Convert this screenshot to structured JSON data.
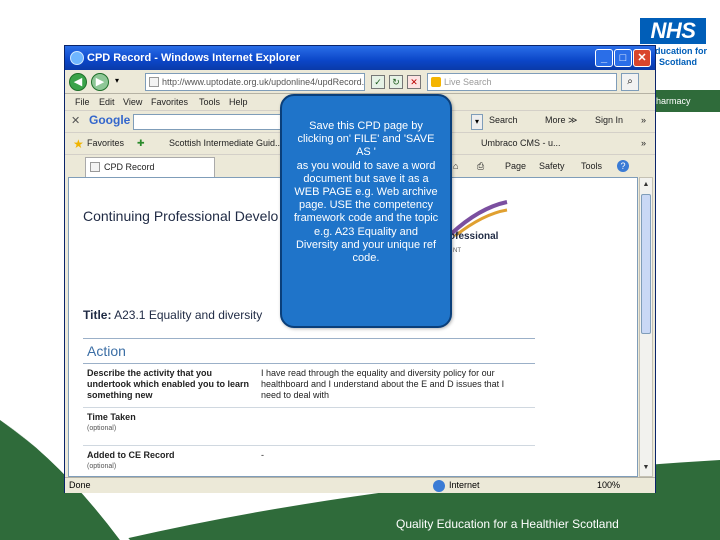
{
  "brand": {
    "logo_text": "NHS",
    "logo_sub": "Education for Scotland",
    "band_text": "harmacy",
    "footer_text": "Quality Education for a Healthier Scotland",
    "green": "#2f6b3a",
    "blue": "#005eb8"
  },
  "window": {
    "title": "CPD Record - Windows Internet Explorer",
    "url": "http://www.uptodate.org.uk/updonline4/updRecord.asp",
    "live_search_placeholder": "Live Search",
    "buttons": [
      "minimize",
      "maximize",
      "close"
    ]
  },
  "menu": {
    "items": [
      "File",
      "Edit",
      "View",
      "Favorites",
      "Tools",
      "Help"
    ]
  },
  "google_bar": {
    "logo": "Google",
    "search_label": "Search",
    "more_label": "More ≫",
    "signin_label": "Sign In",
    "overflow": "»"
  },
  "favorites_bar": {
    "favorites_label": "Favorites",
    "item1": "Scottish Intermediate Guid...",
    "item2": "Umbraco CMS - u...",
    "overflow": "»"
  },
  "tab_bar": {
    "active_tab": "CPD Record",
    "page_label": "Page",
    "safety_label": "Safety",
    "tools_label": "Tools",
    "help_label": "?"
  },
  "page": {
    "heading": "Continuing Professional Develo",
    "brand_word": "ofessional",
    "brand_sub": "NT",
    "title_label": "Title:",
    "title_value": "A23.1 Equality and diversity",
    "action_heading": "Action",
    "rows": [
      {
        "label": "Describe the activity that you undertook which enabled you to learn something new",
        "optional": "",
        "value": "I have read through the equality and diversity policy for our healthboard and I understand about the E and D issues that I need to deal with"
      },
      {
        "label": "Time Taken",
        "optional": "(optional)",
        "value": ""
      },
      {
        "label": "Added to CE Record",
        "optional": "(optional)",
        "value": "-"
      }
    ]
  },
  "status_bar": {
    "left": "Done",
    "zone": "Internet",
    "zoom": "100%"
  },
  "callout": {
    "text": "Save this CPD page by clicking on' FILE' and 'SAVE AS '\nas you would to save a word document but save it as a WEB PAGE e.g. Web archive page. USE the competency framework code and the topic e.g. A23 Equality and Diversity  and your unique ref code.",
    "color": "#1f74c9"
  }
}
